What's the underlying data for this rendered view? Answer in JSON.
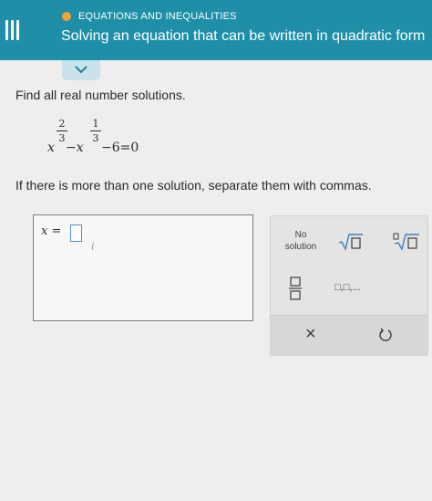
{
  "header": {
    "topic": "EQUATIONS AND INEQUALITIES",
    "title": "Solving an equation that can be written in quadratic form"
  },
  "question": {
    "prompt": "Find all real number solutions.",
    "equation": {
      "base1": "x",
      "exp1_num": "2",
      "exp1_den": "3",
      "minus_x": "−x",
      "exp2_num": "1",
      "exp2_den": "3",
      "tail": "−6=0"
    },
    "instruction": "If there is more than one solution, separate them with commas."
  },
  "answer": {
    "label": "x =",
    "value": ""
  },
  "keypad": {
    "no_solution": "No solution",
    "list_label": "□,□,...",
    "clear_symbol": "×"
  }
}
